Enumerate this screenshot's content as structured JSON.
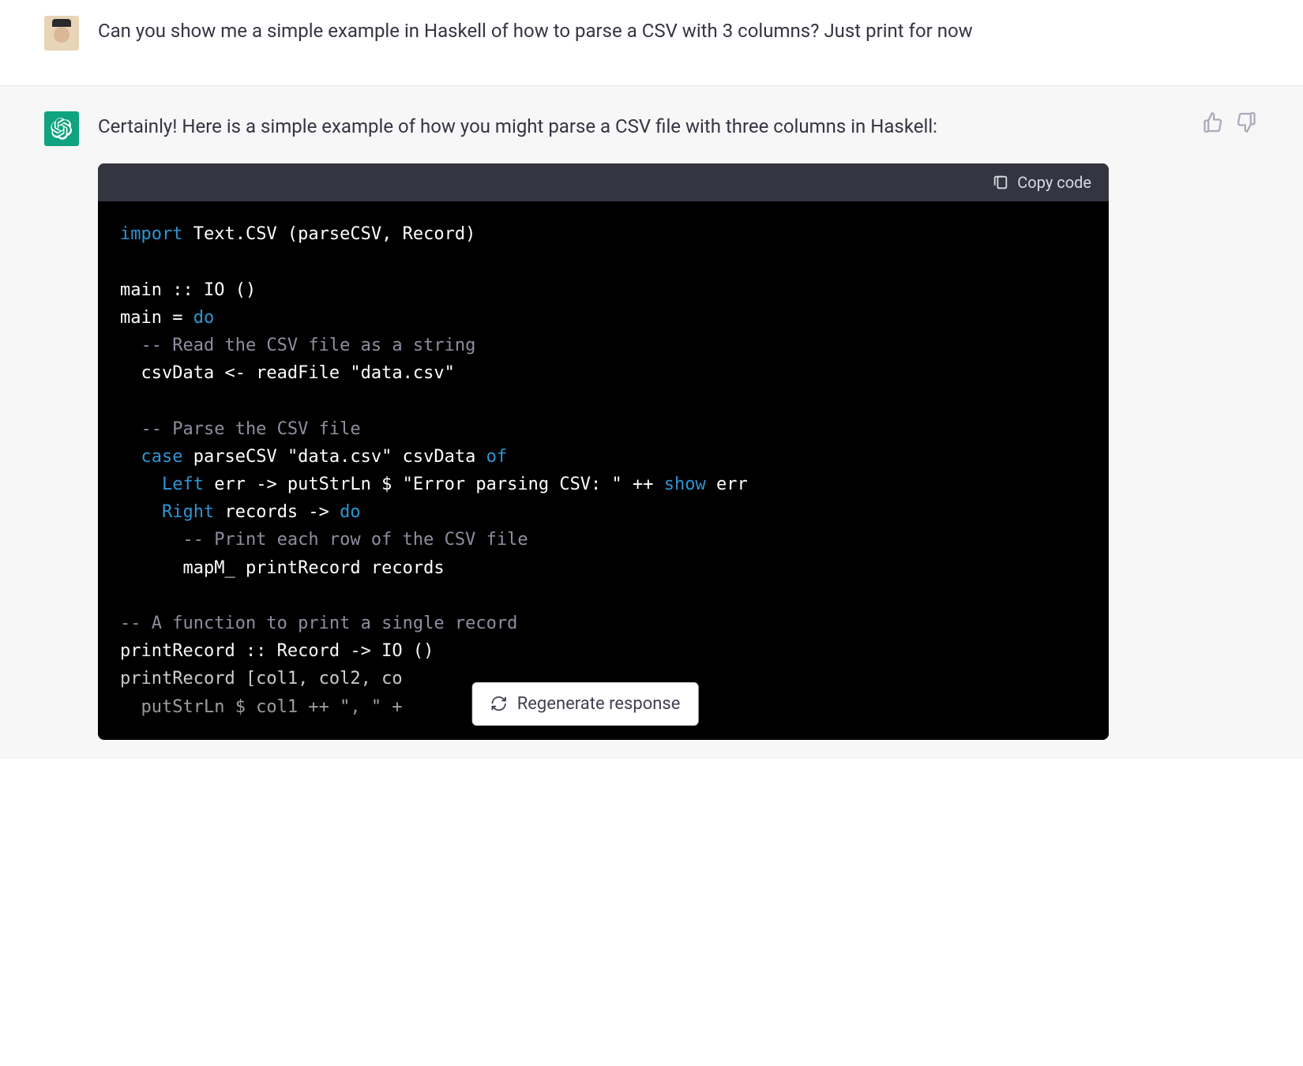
{
  "user_message": "Can you show me a simple example in Haskell of how to parse a CSV with 3 columns? Just print for now",
  "assistant_intro": "Certainly! Here is a simple example of how you might parse a CSV file with three columns in Haskell:",
  "copy_label": "Copy code",
  "regenerate_label": "Regenerate response",
  "code": {
    "l1a": "import",
    "l1b": " Text.CSV (parseCSV, Record)",
    "l3": "main :: IO ()",
    "l4a": "main = ",
    "l4b": "do",
    "l5": "  -- Read the CSV file as a string",
    "l6a": "  csvData <- readFile ",
    "l6b": "\"data.csv\"",
    "l8": "  -- Parse the CSV file",
    "l9a": "  ",
    "l9b": "case",
    "l9c": " parseCSV ",
    "l9d": "\"data.csv\"",
    "l9e": " csvData ",
    "l9f": "of",
    "l10a": "    ",
    "l10b": "Left",
    "l10c": " err -> putStrLn $ ",
    "l10d": "\"Error parsing CSV: \"",
    "l10e": " ++ ",
    "l10f": "show",
    "l10g": " err",
    "l11a": "    ",
    "l11b": "Right",
    "l11c": " records -> ",
    "l11d": "do",
    "l12": "      -- Print each row of the CSV file",
    "l13": "      mapM_ printRecord records",
    "l15": "-- A function to print a single record",
    "l16": "printRecord :: Record -> IO ()",
    "l17": "printRecord [col1, col2, co",
    "l18a": "  putStrLn $ col1 ++ ",
    "l18b": "\", \"",
    "l18c": " +"
  }
}
